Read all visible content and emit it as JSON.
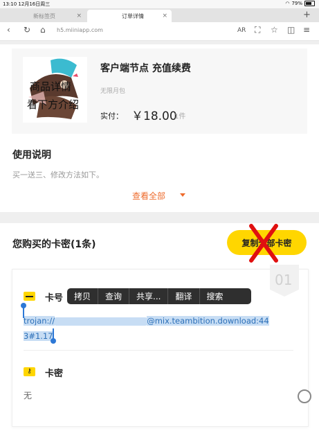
{
  "status_bar": {
    "time": "13:10",
    "date": "12月16日周三",
    "battery": "79%"
  },
  "tabs": [
    {
      "label": "新标签页",
      "close": "×"
    },
    {
      "label": "订单详情",
      "close": "×"
    }
  ],
  "new_tab_icon": "plus-icon",
  "address_bar": {
    "url": "h5.miiniapp.com",
    "buttons": [
      "back-icon",
      "reload-icon",
      "home-icon",
      "ar-icon",
      "fullscreen-icon",
      "star-icon",
      "reader-icon",
      "menu-icon"
    ],
    "ar_label": "AR"
  },
  "product": {
    "thumb_line1": "商品详情",
    "thumb_line2": "看下方介绍",
    "title": "客户端节点 充值续费",
    "subtitle": "无限月包",
    "price_label": "实付：",
    "price": "￥18.00",
    "quantity": "1件"
  },
  "usage": {
    "title": "使用说明",
    "text": "买一送三、修改方法如下。",
    "view_all": "查看全部"
  },
  "purchased": {
    "title": "您购买的卡密(1条)",
    "copy_all": "复制全部卡密",
    "card_index": "01",
    "card_no_label": "卡号",
    "card_value_prefix": "trojan://",
    "card_value_suffix": "@mix.teambition.download:44",
    "card_value_line2": "3#1.17",
    "secret_label": "卡密",
    "secret_value": "无"
  },
  "context_menu": [
    "拷贝",
    "查询",
    "共享...",
    "翻译",
    "搜索"
  ],
  "colors": {
    "accent_yellow": "#ffd600",
    "accent_orange": "#ee6b2c",
    "selection_blue": "#2d78d6",
    "strike_red": "#e01010"
  }
}
